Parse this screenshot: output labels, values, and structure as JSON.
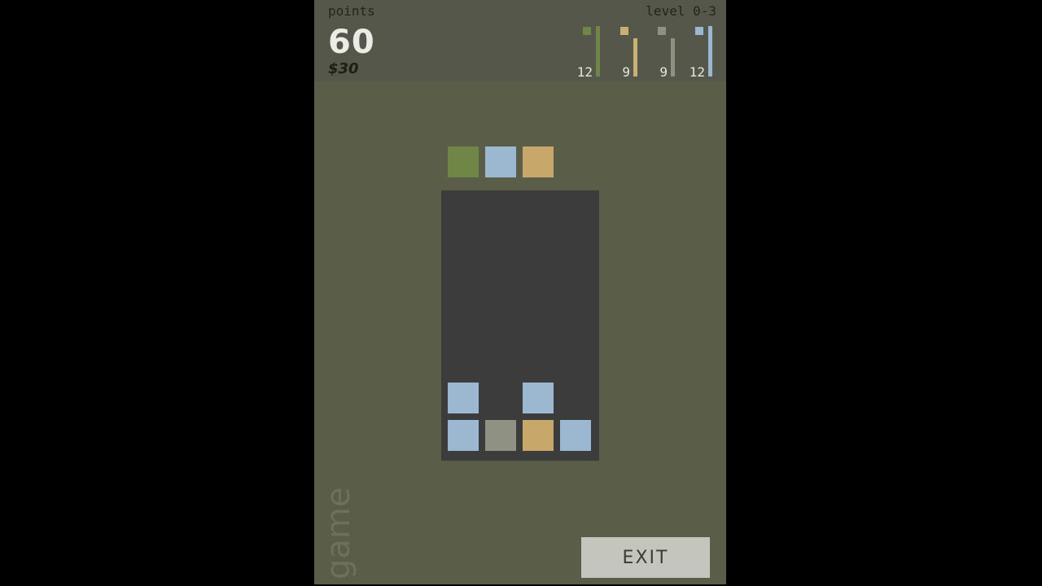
{
  "header": {
    "points_label": "points",
    "level_label": "level 0-3",
    "score": "60",
    "sub_score": "$30"
  },
  "counters": [
    {
      "color": "#6f8646",
      "count": "12",
      "level": 1.0
    },
    {
      "color": "#c8b074",
      "count": "9",
      "level": 0.75
    },
    {
      "color": "#8f9183",
      "count": "9",
      "level": 0.75
    },
    {
      "color": "#9cb8d0",
      "count": "12",
      "level": 1.0
    }
  ],
  "colors": {
    "green": "#6f8646",
    "blue": "#9cb8d0",
    "tan": "#c8a86a",
    "gray": "#8f9183"
  },
  "next_piece": [
    "green",
    "blue",
    "tan"
  ],
  "board": {
    "columns": 4,
    "rows": 7,
    "cells": [
      {
        "row": 5,
        "col": 0,
        "color": "blue"
      },
      {
        "row": 5,
        "col": 2,
        "color": "blue"
      },
      {
        "row": 6,
        "col": 0,
        "color": "blue"
      },
      {
        "row": 6,
        "col": 1,
        "color": "gray"
      },
      {
        "row": 6,
        "col": 2,
        "color": "tan"
      },
      {
        "row": 6,
        "col": 3,
        "color": "blue"
      }
    ]
  },
  "watermark": "game",
  "exit_label": "EXIT"
}
